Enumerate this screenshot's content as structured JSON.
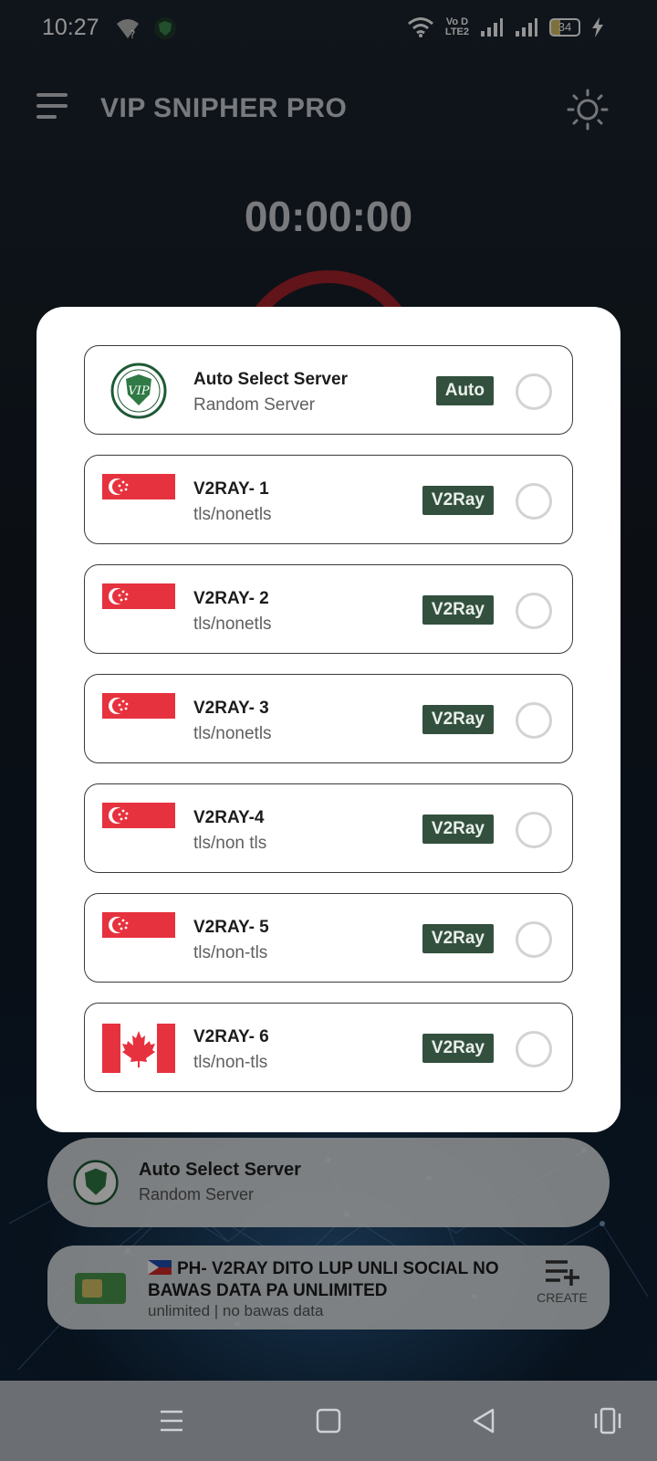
{
  "status_bar": {
    "time": "10:27",
    "volte_top": "Vo D",
    "volte_bottom": "LTE2",
    "battery": "34"
  },
  "app": {
    "title": "VIP SNIPHER PRO",
    "timer": "00:00:00",
    "accent_color": "#33503e"
  },
  "dialog": {
    "servers": [
      {
        "name": "Auto Select Server",
        "protocol": "Random Server",
        "badge": "Auto",
        "flag": "vip-logo",
        "selected": false
      },
      {
        "name": "V2RAY- 1",
        "protocol": "tls/nonetls",
        "badge": "V2Ray",
        "flag": "singapore",
        "selected": false
      },
      {
        "name": "V2RAY- 2",
        "protocol": "tls/nonetls",
        "badge": "V2Ray",
        "flag": "singapore",
        "selected": false
      },
      {
        "name": "V2RAY- 3",
        "protocol": "tls/nonetls",
        "badge": "V2Ray",
        "flag": "singapore",
        "selected": false
      },
      {
        "name": "V2RAY-4",
        "protocol": "tls/non tls",
        "badge": "V2Ray",
        "flag": "singapore",
        "selected": false
      },
      {
        "name": "V2RAY- 5",
        "protocol": "tls/non-tls",
        "badge": "V2Ray",
        "flag": "singapore",
        "selected": false
      },
      {
        "name": "V2RAY- 6",
        "protocol": "tls/non-tls",
        "badge": "V2Ray",
        "flag": "canada",
        "selected": false
      }
    ]
  },
  "selected_server": {
    "name": "Auto Select Server",
    "protocol": "Random Server"
  },
  "config": {
    "title": "PH- V2RAY DITO LUP UNLI SOCIAL NO BAWAS DATA PA UNLIMITED",
    "subtitle": "unlimited | no bawas data",
    "create_label": "CREATE"
  },
  "icons": [
    "menu-icon",
    "brightness-icon",
    "wifi-icon",
    "signal-icon",
    "battery-icon",
    "charging-icon",
    "sim-card-icon",
    "playlist-add-icon",
    "recents-icon",
    "home-icon",
    "back-icon",
    "rotate-icon"
  ]
}
